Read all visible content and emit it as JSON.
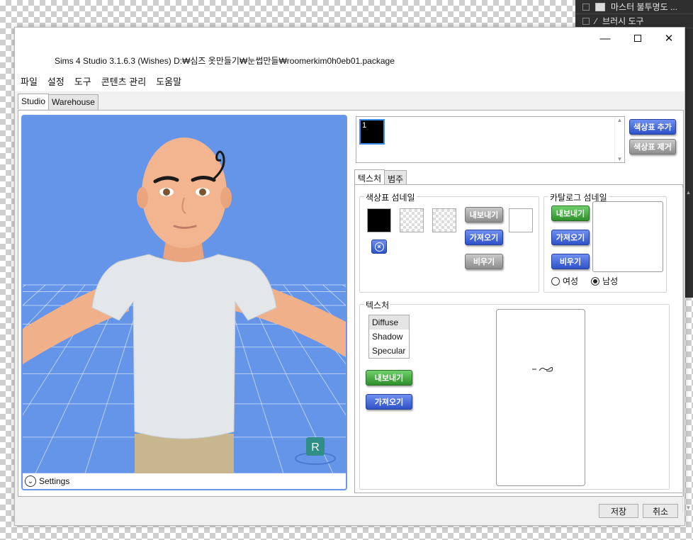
{
  "window": {
    "title": "Sims 4 Studio 3.1.6.3 (Wishes)  D:₩심즈 옷만들기₩눈썹만들₩roomerkim0h0eb01.package",
    "minimize": "—",
    "close": "✕"
  },
  "menu": [
    "파일",
    "설정",
    "도구",
    "콘텐츠 관리",
    "도움말"
  ],
  "tabs": [
    "Studio",
    "Warehouse"
  ],
  "viewport": {
    "settings_label": "Settings",
    "badge_letter": "R",
    "colors": {
      "background": "#6495e9",
      "skin": "#f0b08a",
      "shirt": "#e4e7ea",
      "pants": "#c8b78e",
      "grid": "#ffffff"
    }
  },
  "swatch_list": {
    "item_label": "1"
  },
  "swatch_buttons": {
    "add": "색상표 추가",
    "remove": "색상표 제거"
  },
  "subtabs": [
    "텍스처",
    "범주"
  ],
  "swatch_thumbnail": {
    "title": "색상표 섬네일",
    "export": "내보내기",
    "import": "가져오기",
    "clear": "비우기"
  },
  "catalog_thumbnail": {
    "title": "카탈로그 섬네일",
    "export": "내보내기",
    "import": "가져오기",
    "clear": "비우기",
    "female": "여성",
    "male": "남성",
    "selected_gender": "male"
  },
  "texture": {
    "title": "텍스처",
    "items": [
      "Diffuse",
      "Shadow",
      "Specular"
    ],
    "selected": "Diffuse",
    "export": "내보내기",
    "import": "가져오기"
  },
  "footer": {
    "save": "저장",
    "cancel": "취소"
  },
  "background_layers": [
    "마스터 불투명도 ...",
    "브러시 도구"
  ]
}
